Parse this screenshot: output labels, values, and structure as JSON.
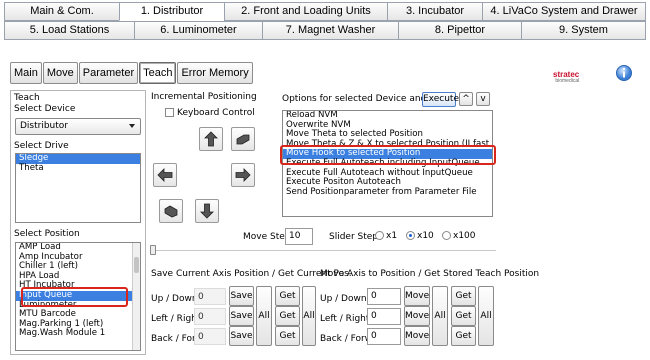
{
  "top_tabs_row1": [
    "Main & Com.",
    "1. Distributor",
    "2. Front and Loading Units",
    "3. Incubator",
    "4. LiVaCo System and Drawer"
  ],
  "top_tabs_row2": [
    "5. Load Stations",
    "6. Luminometer",
    "7. Magnet Washer",
    "8. Pipettor",
    "9. System"
  ],
  "sub_tabs": [
    "Main",
    "Move",
    "Parameter",
    "Teach",
    "Error Memory"
  ],
  "logo_text": "stratec",
  "logo_sub": "biomedical",
  "teach": {
    "title": "Teach",
    "select_device_label": "Select Device",
    "device_value": "Distributor",
    "select_drive_label": "Select Drive",
    "drives": [
      "Sledge",
      "Theta"
    ],
    "select_position_label": "Select Position",
    "positions": [
      "AMP Load",
      "Amp Incubator",
      "Chiller 1 (left)",
      "HPA Load",
      "HT Incubator",
      "Input Queue",
      "Luminometer",
      "MTU Barcode",
      "Mag.Parking 1 (left)",
      "Mag.Wash Module 1"
    ]
  },
  "incremental": {
    "title": "Incremental Positioning",
    "keyboard_control": "Keyboard Control",
    "move_step_label": "Move Step",
    "move_step_value": "10",
    "slider_step_label": "Slider Step",
    "slider_options": [
      "x1",
      "x10",
      "x100"
    ],
    "slider_selected": "x10"
  },
  "options": {
    "title": "Options for selected Device and Drive",
    "execute": "Execute",
    "up": "^",
    "down": "v",
    "items": [
      "Reload NVM",
      "Overwrite NVM",
      "Move Theta to selected Position",
      "Move Theta & Z & X to selected Position (II fast move !!)",
      "Move Hook to selected Position",
      "Execute Full Autoteach including InputQueue",
      "Execute Full Autoteach without InputQueue",
      "Execute Positon Autoteach",
      "Send Positionparameter from Parameter File"
    ],
    "selected": "Move Hook to selected Position"
  },
  "save_current": {
    "title": "Save Current Axis Position / Get Current Pos.",
    "rows": [
      {
        "label": "Up / Down",
        "value": "0"
      },
      {
        "label": "Left / Right",
        "value": "0"
      },
      {
        "label": "Back / Forw.",
        "value": "0"
      }
    ],
    "save": "Save",
    "get": "Get",
    "all": "All"
  },
  "move_axis": {
    "title": "Move Axis to Position / Get Stored Teach Position",
    "rows": [
      {
        "label": "Up / Down",
        "value": "0"
      },
      {
        "label": "Left / Right",
        "value": "0"
      },
      {
        "label": "Back / Forw.",
        "value": "0"
      }
    ],
    "move": "Move",
    "get": "Get",
    "all": "All"
  }
}
